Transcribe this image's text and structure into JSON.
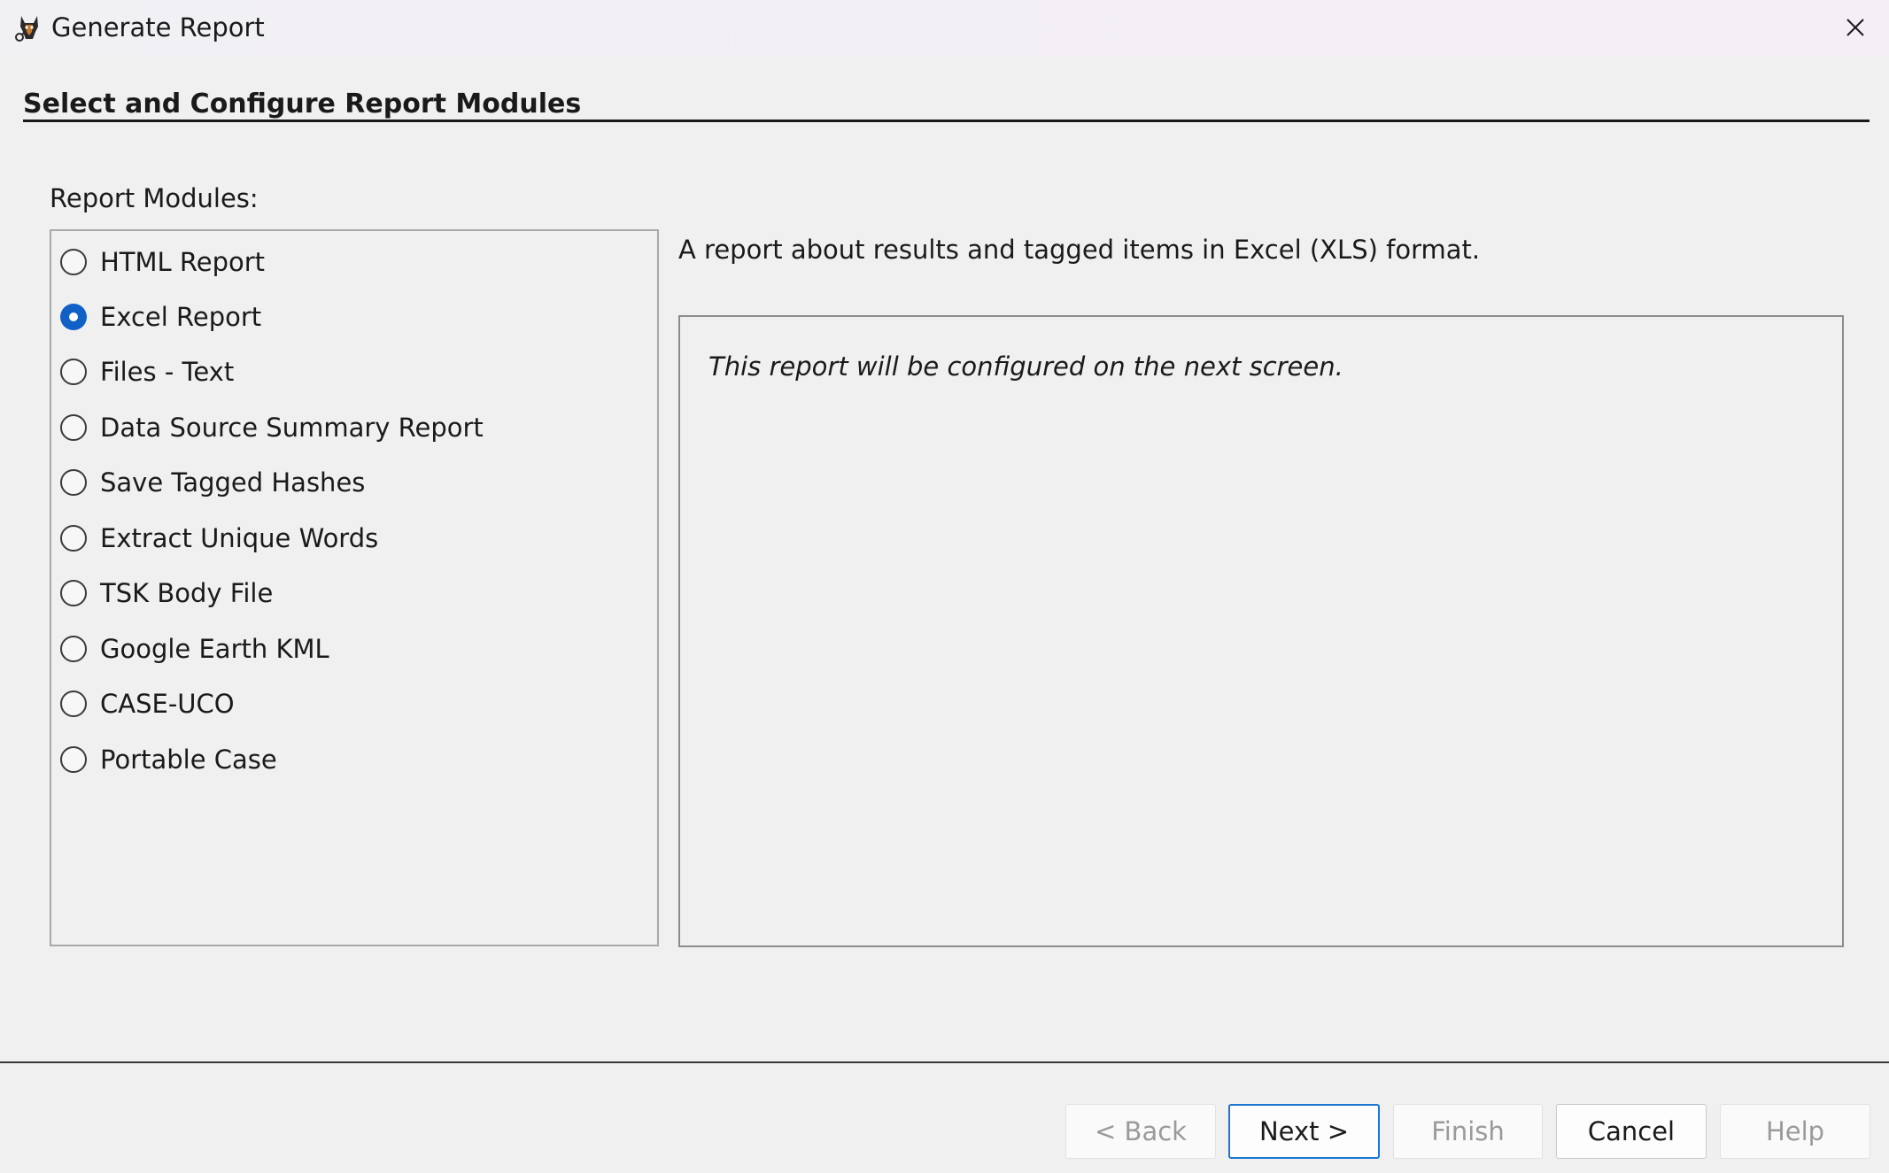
{
  "window": {
    "title": "Generate Report",
    "app_icon": "autopsy-dog-icon",
    "close_icon": "close-icon"
  },
  "section": {
    "heading": "Select and Configure Report Modules"
  },
  "modules": {
    "label": "Report Modules:",
    "selected": "Excel Report",
    "items": [
      {
        "label": "HTML Report",
        "checked": false
      },
      {
        "label": "Excel Report",
        "checked": true
      },
      {
        "label": "Files - Text",
        "checked": false
      },
      {
        "label": "Data Source Summary Report",
        "checked": false
      },
      {
        "label": "Save Tagged Hashes",
        "checked": false
      },
      {
        "label": "Extract Unique Words",
        "checked": false
      },
      {
        "label": "TSK Body File",
        "checked": false
      },
      {
        "label": "Google Earth KML",
        "checked": false
      },
      {
        "label": "CASE-UCO",
        "checked": false
      },
      {
        "label": "Portable Case",
        "checked": false
      }
    ]
  },
  "details": {
    "description": "A report about results and tagged items in Excel (XLS) format.",
    "config_note": "This report will be configured on the next screen."
  },
  "buttons": {
    "back": "< Back",
    "next": "Next >",
    "finish": "Finish",
    "cancel": "Cancel",
    "help": "Help"
  },
  "colors": {
    "accent": "#1160c8",
    "default_button_border": "#1976d2",
    "disabled_text": "#9a9a9a"
  }
}
